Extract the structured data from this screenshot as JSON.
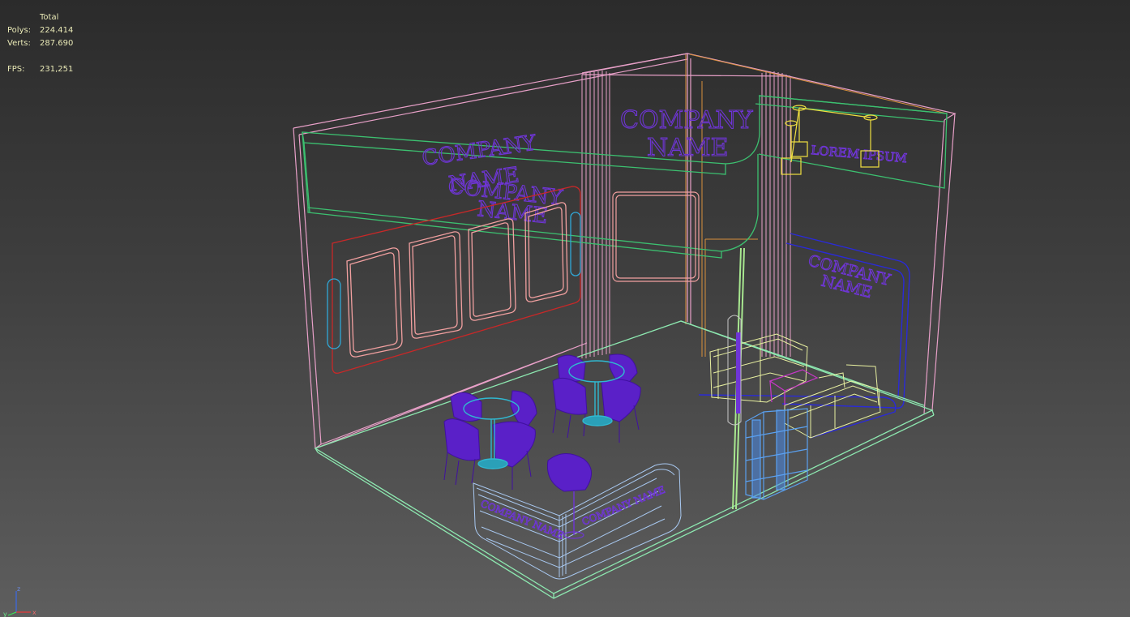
{
  "stats": {
    "header": "Total",
    "polys_label": "Polys:",
    "polys_value": "224.414",
    "verts_label": "Verts:",
    "verts_value": "287.690",
    "fps_label": "FPS:",
    "fps_value": "231,251"
  },
  "scene_text": {
    "left_wall_logo_1a": "COMPANY",
    "left_wall_logo_1b": "NAME",
    "left_wall_logo_2a": "COMPANY",
    "left_wall_logo_2b": "NAME",
    "center_wall_logo_a": "COMPANY",
    "center_wall_logo_b": "NAME",
    "right_wall_logo_a": "COMPANY",
    "right_wall_logo_b": "NAME",
    "lorem_sign": "LOREM IPSUM",
    "counter_logo_left": "COMPANY NAME",
    "counter_logo_right": "COMPANY NAME"
  },
  "gizmo": {
    "z_label": "z",
    "x_label": "x",
    "y_label": "y"
  },
  "colors": {
    "stats_text": "#e9e9b6",
    "wall_pink": "#e8a0c8",
    "floor_green": "#8de8b0",
    "banner_green": "#3cc070",
    "logo_purple": "#6f35d6",
    "frame_red": "#c82828",
    "frame_salmon": "#f2a0a0",
    "furniture_yellow": "#e8f0a0",
    "counter_lightblue": "#a8c8f0",
    "chair_purple": "#5a20c8",
    "table_cyan": "#30b8d0",
    "dark_blue": "#2a2ad8",
    "light_yellow": "#f0e040"
  }
}
